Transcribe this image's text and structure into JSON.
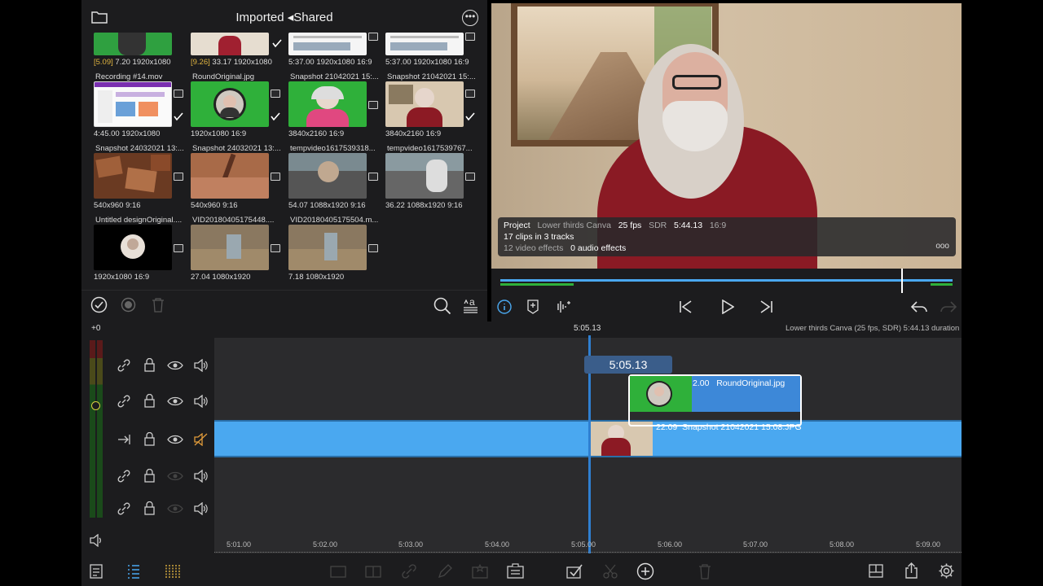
{
  "browser": {
    "title": "Imported ◂Shared",
    "grid": [
      {
        "name": "",
        "meta_gold": "[5.09]",
        "meta": " 7.20  1920x1080"
      },
      {
        "name": "",
        "meta_gold": "[9.26]",
        "meta": " 33.17  1920x1080"
      },
      {
        "name": "",
        "meta_gold": "",
        "meta": "5:37.00  1920x1080  16:9"
      },
      {
        "name": "",
        "meta_gold": "",
        "meta": "5:37.00  1920x1080  16:9"
      },
      {
        "name": "Recording #14.mov",
        "meta_gold": "",
        "meta": "4:45.00  1920x1080"
      },
      {
        "name": "RoundOriginal.jpg",
        "meta_gold": "",
        "meta": "1920x1080  16:9"
      },
      {
        "name": "Snapshot 21042021 15:...",
        "meta_gold": "",
        "meta": "3840x2160  16:9"
      },
      {
        "name": "Snapshot 21042021 15:...",
        "meta_gold": "",
        "meta": "3840x2160  16:9"
      },
      {
        "name": "Snapshot 24032021 13:...",
        "meta_gold": "",
        "meta": "540x960  9:16"
      },
      {
        "name": "Snapshot 24032021 13:...",
        "meta_gold": "",
        "meta": "540x960  9:16"
      },
      {
        "name": "tempvideo1617539318...",
        "meta_gold": "",
        "meta": "54.07  1088x1920  9:16"
      },
      {
        "name": "tempvideo1617539767...",
        "meta_gold": "",
        "meta": "36.22  1088x1920  9:16"
      },
      {
        "name": "Untitled designOriginal....",
        "meta_gold": "",
        "meta": "1920x1080  16:9"
      },
      {
        "name": "VID20180405175448....",
        "meta_gold": "",
        "meta": "27.04  1080x1920"
      },
      {
        "name": "VID20180405175504.m...",
        "meta_gold": "",
        "meta": "7.18  1080x1920"
      }
    ]
  },
  "project_info": {
    "label": "Project",
    "name": "Lower thirds Canva",
    "fps": "25 fps",
    "range": "SDR",
    "duration": "5:44.13",
    "aspect": "16:9",
    "clips": "17 clips in 3 tracks",
    "video_effects": "12 video effects",
    "audio_effects": "0 audio effects",
    "more": "ooo"
  },
  "timeline": {
    "top_offset": "+0",
    "playhead_time": "5:05.13",
    "playhead_bubble": "5:05.13",
    "project_summary": "Lower thirds Canva (25 fps, SDR)  5:44.13 duration",
    "ruler": [
      "5:01.00",
      "5:02.00",
      "5:03.00",
      "5:04.00",
      "5:05.00",
      "5:06.00",
      "5:07.00",
      "5:08.00",
      "5:09.00"
    ],
    "clip_round": {
      "duration": "2.00",
      "name": "RoundOriginal.jpg"
    },
    "clip_snapshot": {
      "duration": "22.09",
      "name": "Snapshot 21042021 15:08.JPG"
    }
  },
  "colors": {
    "accent_blue": "#4aa8f0",
    "track_blue": "#3d9fe8",
    "green": "#2fb03a",
    "gold": "#e0b440",
    "muted_orange": "#e09a3a"
  }
}
